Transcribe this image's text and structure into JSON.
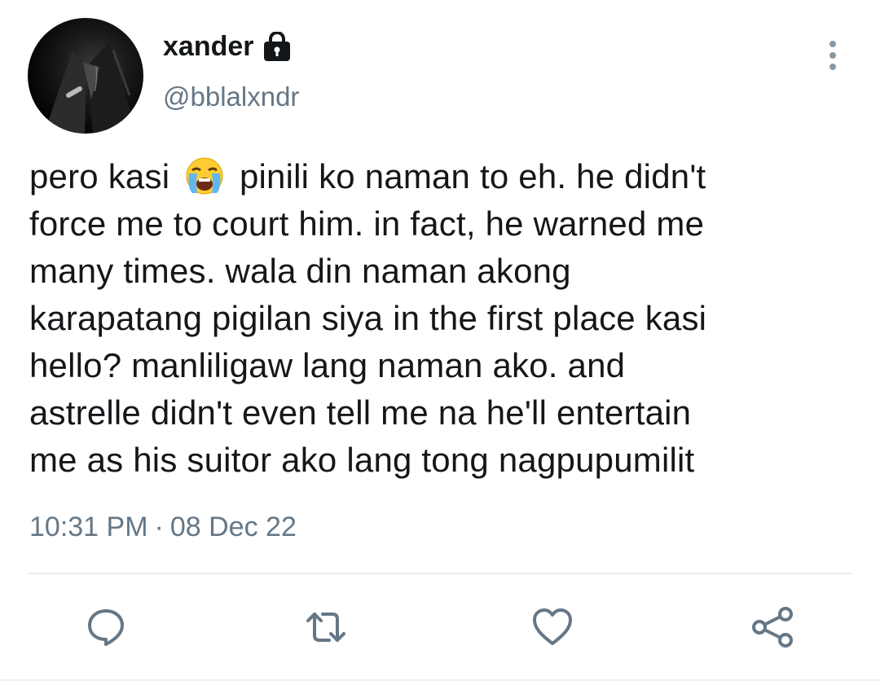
{
  "user": {
    "display_name": "xander",
    "handle": "@bblalxndr",
    "avatar_icon": "profile-photo",
    "protected_icon": "lock-icon"
  },
  "tweet": {
    "lines": [
      {
        "before": "pero kasi ",
        "emoji": "loudly-crying-face",
        "after": " pinili ko naman to eh. he didn't"
      },
      {
        "text": "force me to court him. in fact, he warned me"
      },
      {
        "text": "many times. wala din naman akong"
      },
      {
        "text": "karapatang pigilan siya in the first place kasi"
      },
      {
        "text": "hello? manliligaw lang naman ako. and"
      },
      {
        "text": "astrelle didn't even tell me na he'll entertain"
      },
      {
        "text": "me as his suitor ako lang tong nagpupumilit"
      }
    ],
    "time": "10:31 PM",
    "separator": "·",
    "date": "08 Dec 22"
  },
  "actions": {
    "icons": [
      "reply-icon",
      "retweet-icon",
      "like-icon",
      "share-icon"
    ]
  },
  "colors": {
    "text": "#14171a",
    "muted": "#657786",
    "divider": "#e6ecf0"
  }
}
